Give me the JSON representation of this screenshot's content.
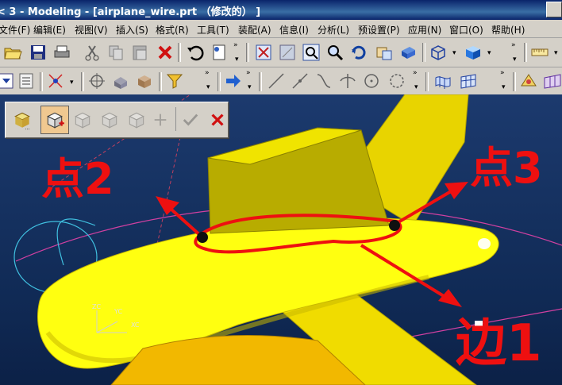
{
  "window": {
    "title": "< 3 - Modeling - [airplane_wire.prt （修改的） ]"
  },
  "menu": [
    "文件(F)",
    "编辑(E)",
    "视图(V)",
    "插入(S)",
    "格式(R)",
    "工具(T)",
    "装配(A)",
    "信息(I)",
    "分析(L)",
    "预设置(P)",
    "应用(N)",
    "窗口(O)",
    "帮助(H)"
  ],
  "toolbar1": {
    "icons": [
      "open-folder-icon",
      "save-icon",
      "print-icon",
      "cut-icon",
      "copy-icon",
      "paste-icon",
      "delete-icon",
      "undo-icon",
      "layer-icon",
      "fit-icon",
      "view-rotate-icon",
      "zoom-window-icon",
      "zoom-icon",
      "rotate-icon",
      "pan-icon",
      "render-icon",
      "wireframe-icon",
      "shaded-icon",
      "measure-icon"
    ]
  },
  "toolbar2": {
    "icons": [
      "select-dropdown-icon",
      "filter-list-icon",
      "point-construct-icon",
      "snap-point-icon",
      "feature-icon",
      "body-icon",
      "filter-icon",
      "arrow-right-icon",
      "line-icon",
      "line-tool-icon",
      "arc-icon",
      "intersection-icon",
      "circle-icon",
      "circle-dash-icon",
      "surface-icon",
      "mesh-icon",
      "analysis-icon",
      "mesh2-icon"
    ]
  },
  "selection_toolbar": {
    "icons": [
      "edit-sketch-icon",
      "object-select-icon",
      "cube-select-icon",
      "cube-select2-icon",
      "cube-select3-icon",
      "point-select-icon",
      "ok-check-icon",
      "cancel-x-icon"
    ]
  },
  "axes": {
    "zc": "ZC",
    "yc": "YC",
    "xc": "XC"
  },
  "annotations": {
    "point2": "点2",
    "point3": "点3",
    "edge1": "边1"
  },
  "colors": {
    "model": "#ffff00",
    "model_shadow": "#c8b800",
    "annotation": "#ee1010",
    "viewport": "#16346a"
  }
}
